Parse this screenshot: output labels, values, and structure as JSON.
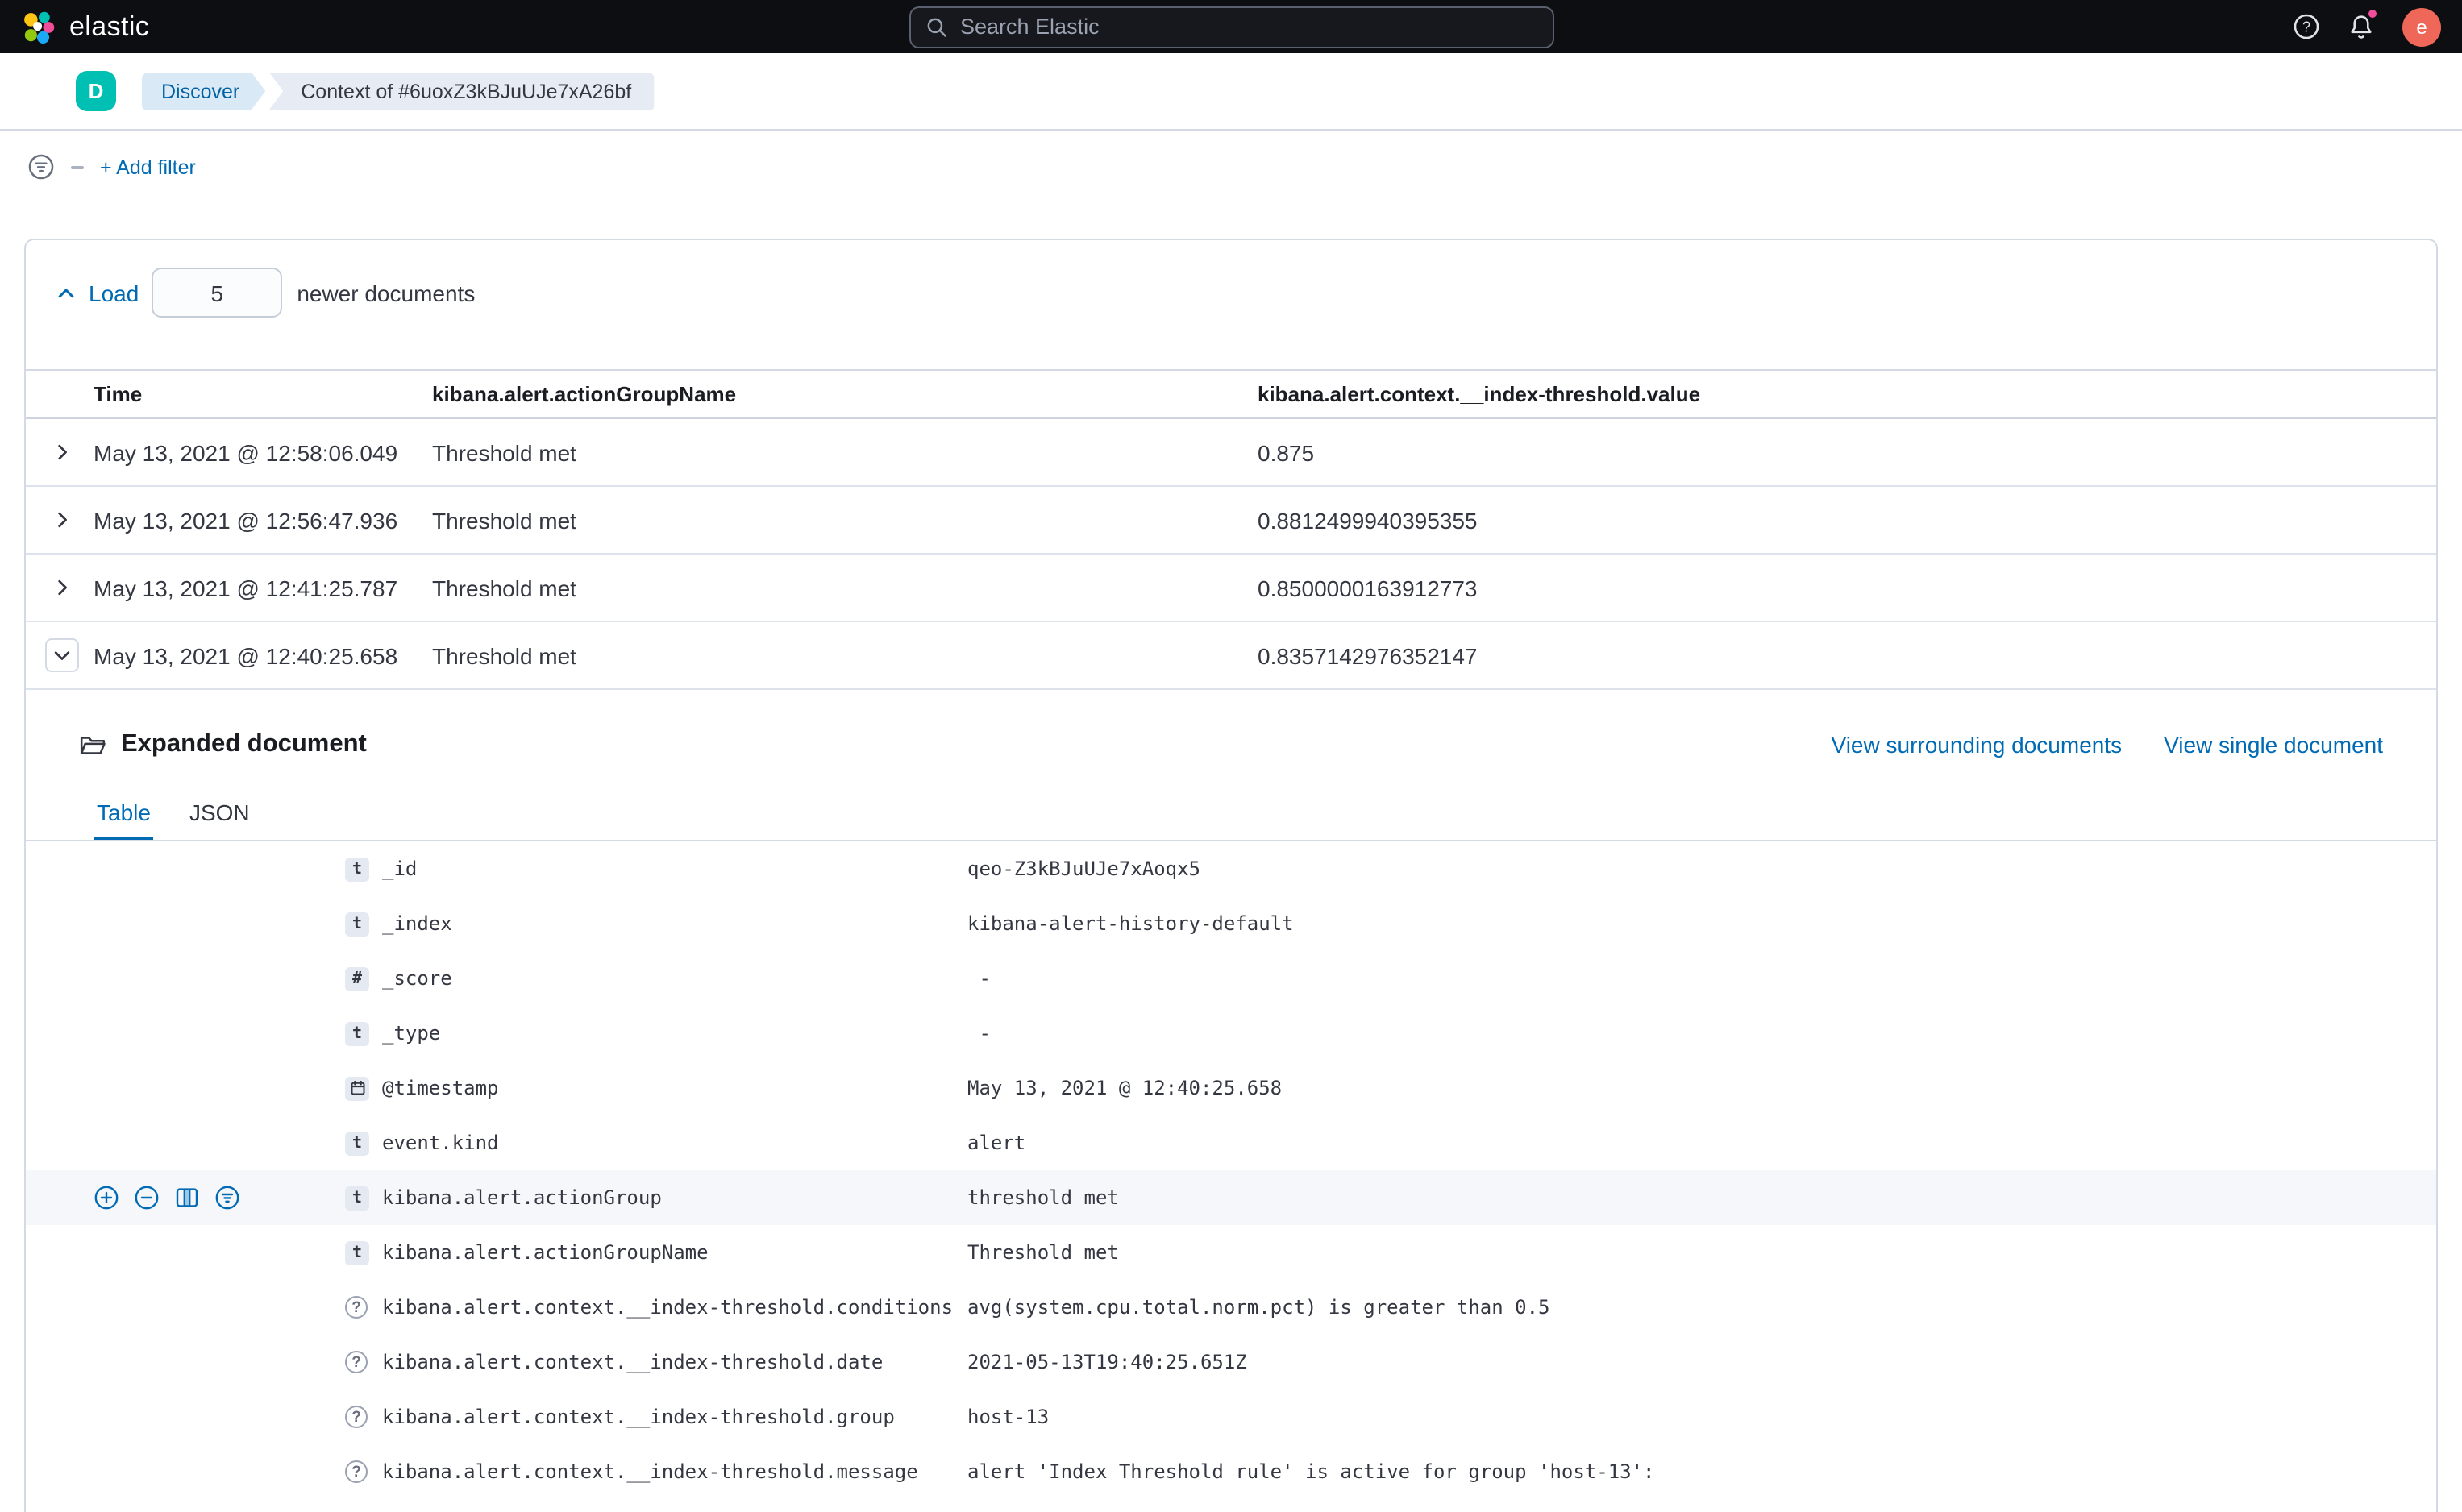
{
  "top_bar": {
    "logo_text": "elastic",
    "search_placeholder": "Search Elastic",
    "avatar_initial": "e"
  },
  "nav_bar": {
    "space_initial": "D",
    "breadcrumbs": {
      "discover": "Discover",
      "context": "Context of #6uoxZ3kBJuUJe7xA26bf"
    }
  },
  "filter_bar": {
    "add_filter": "+ Add filter"
  },
  "load_bar": {
    "load_label": "Load",
    "count": "5",
    "suffix": "newer documents"
  },
  "doc_table": {
    "columns": {
      "time": "Time",
      "action_group": "kibana.alert.actionGroupName",
      "value": "kibana.alert.context.__index-threshold.value"
    },
    "rows": [
      {
        "time": "May 13, 2021 @ 12:58:06.049",
        "group": "Threshold met",
        "value": "0.875"
      },
      {
        "time": "May 13, 2021 @ 12:56:47.936",
        "group": "Threshold met",
        "value": "0.8812499940395355"
      },
      {
        "time": "May 13, 2021 @ 12:41:25.787",
        "group": "Threshold met",
        "value": "0.8500000163912773"
      },
      {
        "time": "May 13, 2021 @ 12:40:25.658",
        "group": "Threshold met",
        "value": "0.8357142976352147"
      }
    ]
  },
  "expanded": {
    "title": "Expanded document",
    "view_surrounding": "View surrounding documents",
    "view_single": "View single document",
    "tabs": {
      "table": "Table",
      "json": "JSON"
    },
    "fields": [
      {
        "name": "_id",
        "value": "qeo-Z3kBJuUJe7xAoqx5"
      },
      {
        "name": "_index",
        "value": "kibana-alert-history-default"
      },
      {
        "name": "_score",
        "value": " - "
      },
      {
        "name": "_type",
        "value": " - "
      },
      {
        "name": "@timestamp",
        "value": "May 13, 2021 @ 12:40:25.658"
      },
      {
        "name": "event.kind",
        "value": "alert"
      },
      {
        "name": "kibana.alert.actionGroup",
        "value": "threshold met"
      },
      {
        "name": "kibana.alert.actionGroupName",
        "value": "Threshold met"
      },
      {
        "name": "kibana.alert.context.__index-threshold.conditions",
        "value": "avg(system.cpu.total.norm.pct) is greater than 0.5"
      },
      {
        "name": "kibana.alert.context.__index-threshold.date",
        "value": "2021-05-13T19:40:25.651Z"
      },
      {
        "name": "kibana.alert.context.__index-threshold.group",
        "value": "host-13"
      },
      {
        "name": "kibana.alert.context.__index-threshold.message",
        "value": "alert 'Index Threshold rule' is active for group 'host-13':"
      }
    ]
  },
  "icons": {
    "text_token": "t",
    "number_token": "#",
    "unknown_token": "?"
  },
  "colors": {
    "accent_blue": "#006BB4",
    "space_teal": "#00BFB3",
    "notification_pink": "#F04E98",
    "border": "#D3DAE6"
  }
}
